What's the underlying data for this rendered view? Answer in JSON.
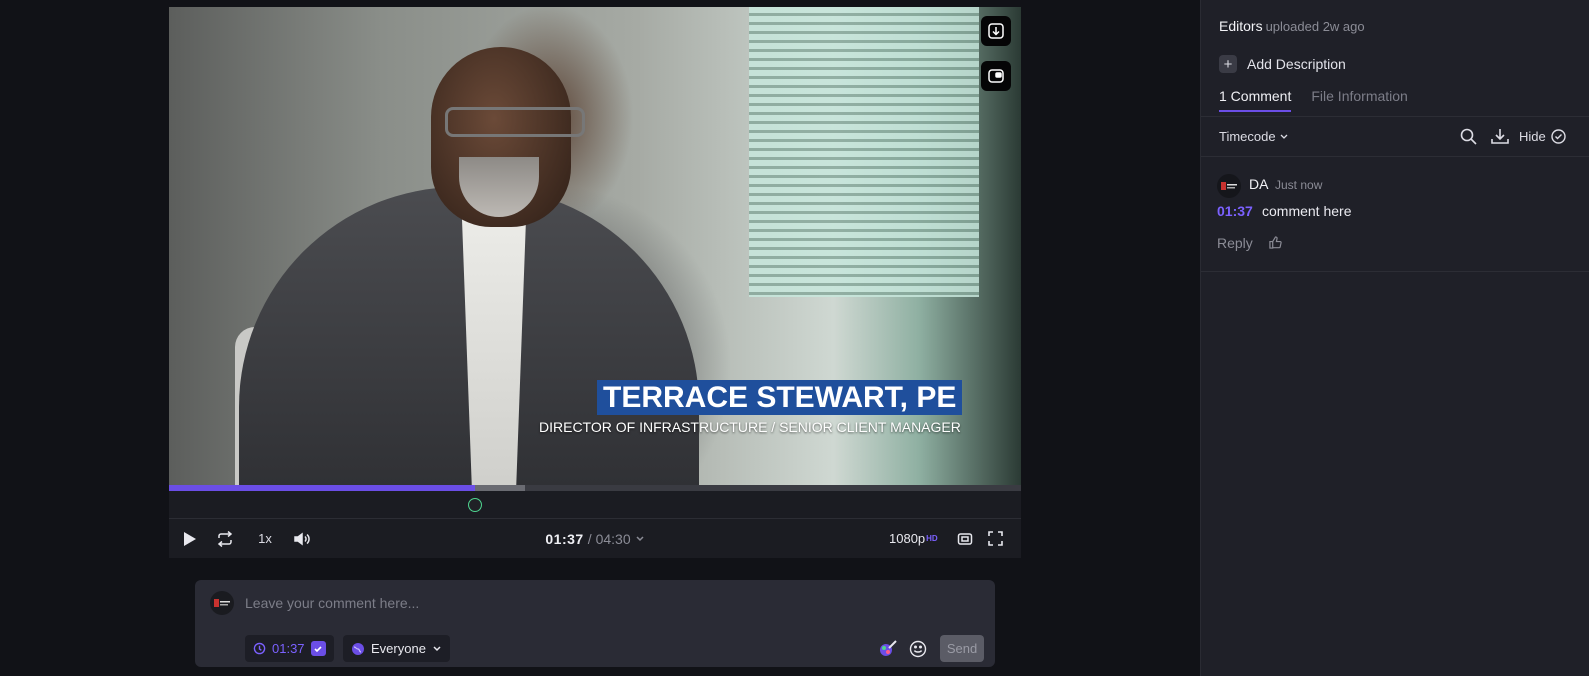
{
  "video": {
    "lower_third_name": "TERRACE STEWART, PE",
    "lower_third_title": "DIRECTOR OF INFRASTRUCTURE / SENIOR CLIENT MANAGER",
    "progress_fraction": 0.359,
    "buffer_fraction": 0.418,
    "marker_fraction": 0.359
  },
  "player": {
    "speed": "1x",
    "current_time": "01:37",
    "separator": "/",
    "total_time": "04:30",
    "quality": "1080p",
    "quality_badge": "HD"
  },
  "composer": {
    "placeholder": "Leave your comment here...",
    "timecode": "01:37",
    "audience": "Everyone",
    "send_label": "Send"
  },
  "panel": {
    "uploader": "Editors",
    "uploaded_when": "uploaded 2w ago",
    "add_description": "Add Description",
    "tabs": [
      {
        "label": "1 Comment",
        "active": true
      },
      {
        "label": "File Information",
        "active": false
      }
    ],
    "sort_label": "Timecode",
    "hide_label": "Hide"
  },
  "comments": [
    {
      "author": "DA",
      "time": "Just now",
      "timestamp": "01:37",
      "text": "comment here",
      "reply_label": "Reply"
    }
  ],
  "colors": {
    "accent": "#6b4ee6",
    "accent_text": "#7b61ff",
    "lower_third_bg": "#1f4f9c"
  }
}
